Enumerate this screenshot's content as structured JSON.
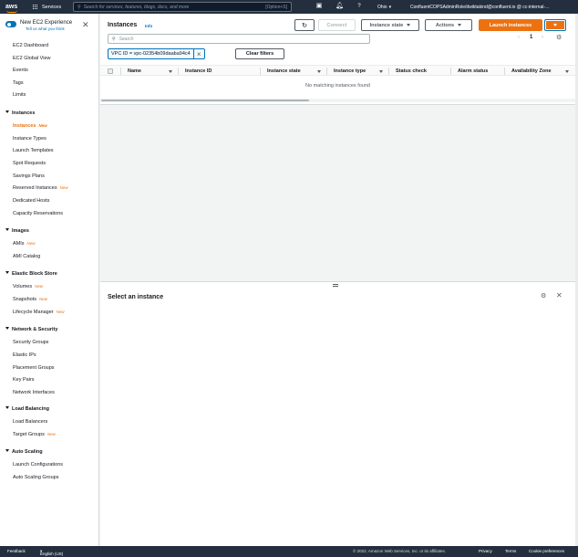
{
  "topnav": {
    "logo": "aws",
    "services_label": "Services",
    "search_placeholder": "Search for services, features, blogs, docs, and more",
    "search_hint": "[Option+S]",
    "region": "Ohio",
    "account": "ConfluentCOPSAdminRole/dwiktakind@confluent.io @ cc-internal-...",
    "icons": [
      "cloudshell-icon",
      "bell-icon",
      "help-icon"
    ]
  },
  "sidebar": {
    "toggle_title": "New EC2 Experience",
    "toggle_sub": "Tell us what you think",
    "top_items": [
      "EC2 Dashboard",
      "EC2 Global View",
      "Events",
      "Tags",
      "Limits"
    ],
    "sections": [
      {
        "title": "Instances",
        "items": [
          {
            "label": "Instances",
            "badge": "New",
            "active": true
          },
          {
            "label": "Instance Types"
          },
          {
            "label": "Launch Templates"
          },
          {
            "label": "Spot Requests"
          },
          {
            "label": "Savings Plans"
          },
          {
            "label": "Reserved Instances",
            "badge": "New"
          },
          {
            "label": "Dedicated Hosts"
          },
          {
            "label": "Capacity Reservations"
          }
        ]
      },
      {
        "title": "Images",
        "items": [
          {
            "label": "AMIs",
            "badge": "New"
          },
          {
            "label": "AMI Catalog"
          }
        ]
      },
      {
        "title": "Elastic Block Store",
        "items": [
          {
            "label": "Volumes",
            "badge": "New"
          },
          {
            "label": "Snapshots",
            "badge": "New"
          },
          {
            "label": "Lifecycle Manager",
            "badge": "New"
          }
        ]
      },
      {
        "title": "Network & Security",
        "items": [
          {
            "label": "Security Groups"
          },
          {
            "label": "Elastic IPs"
          },
          {
            "label": "Placement Groups"
          },
          {
            "label": "Key Pairs"
          },
          {
            "label": "Network Interfaces"
          }
        ]
      },
      {
        "title": "Load Balancing",
        "items": [
          {
            "label": "Load Balancers"
          },
          {
            "label": "Target Groups",
            "badge": "New"
          }
        ]
      },
      {
        "title": "Auto Scaling",
        "items": [
          {
            "label": "Launch Configurations"
          },
          {
            "label": "Auto Scaling Groups"
          }
        ]
      }
    ]
  },
  "instances": {
    "title": "Instances",
    "info": "Info",
    "connect": "Connect",
    "instance_state": "Instance state",
    "actions": "Actions",
    "launch": "Launch instances",
    "search_placeholder": "Search",
    "page": "1",
    "filter_token": "VPC ID = vpc-02354b09daaba94c4",
    "clear_filters": "Clear filters",
    "columns": [
      "Name",
      "Instance ID",
      "Instance state",
      "Instance type",
      "Status check",
      "Alarm status",
      "Availability Zone"
    ],
    "empty": "No matching instances found"
  },
  "detail": {
    "title": "Select an instance"
  },
  "footer": {
    "feedback": "Feedback",
    "language": "English (US)",
    "copyright": "© 2022, Amazon Web Services, Inc. or its affiliates.",
    "privacy": "Privacy",
    "terms": "Terms",
    "cookies": "Cookie preferences"
  },
  "colors": {
    "nav_bg": "#232f3e",
    "accent_orange": "#ec7211",
    "link_blue": "#0073bb"
  }
}
